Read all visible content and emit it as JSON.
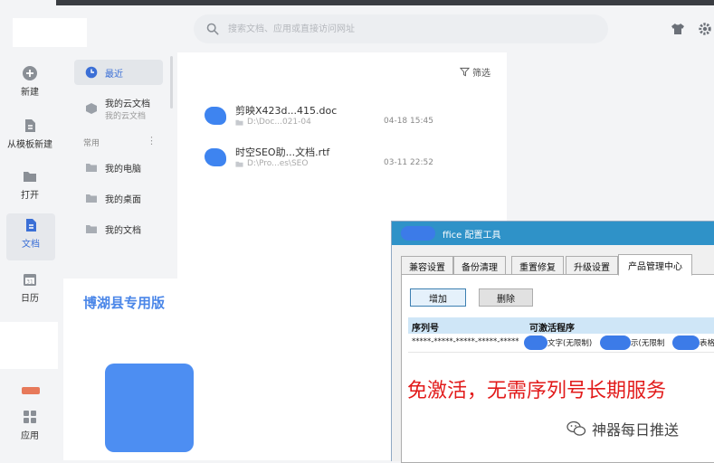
{
  "search": {
    "placeholder": "搜索文档、应用或直接访问网址"
  },
  "rail": [
    {
      "label": "新建",
      "icon": "plus-circle-icon"
    },
    {
      "label": "从模板新建",
      "icon": "template-icon"
    },
    {
      "label": "打开",
      "icon": "folder-icon"
    },
    {
      "label": "文档",
      "icon": "document-icon",
      "active": true
    },
    {
      "label": "日历",
      "icon": "calendar-icon"
    },
    {
      "label": "应用",
      "icon": "apps-grid-icon"
    }
  ],
  "nav": {
    "recent": "最近",
    "cloud": "我的云文档",
    "cloud_sub": "我的云文档",
    "section_common": "常用",
    "my_computer": "我的电脑",
    "my_desktop": "我的桌面",
    "my_documents": "我的文档"
  },
  "main": {
    "filter_label": "筛选",
    "files": [
      {
        "name": "剪映X423d...415.doc",
        "path": "D:\\Doc...021-04",
        "date": "04-18 15:45"
      },
      {
        "name": "时空SEO助...文档.rtf",
        "path": "D:\\Pro...es\\SEO",
        "date": "03-11 22:52"
      }
    ]
  },
  "overlay": {
    "version_label": "博湖县专用版",
    "red_banner": "免激活，无需序列号长期服务",
    "wechat_label": "神器每日推送"
  },
  "dialog": {
    "title": "Office 配置工具",
    "title_visible": "ffice 配置工具",
    "tabs": [
      "兼容设置",
      "备份清理",
      "重置修复",
      "升级设置",
      "产品管理中心"
    ],
    "active_tab": 4,
    "add_button": "增加",
    "delete_button": "删除",
    "table_headers": [
      "序列号",
      "可激活程序"
    ],
    "row": {
      "serial": "*****-*****-*****-*****-*****",
      "program_1": "文字(无限制)",
      "program_2": "示(无限制",
      "program_3": "表格"
    }
  },
  "colors": {
    "accent": "#3b6fd6",
    "dialog_title_bar": "#2f92c8",
    "banner_red": "#e21b1b"
  }
}
